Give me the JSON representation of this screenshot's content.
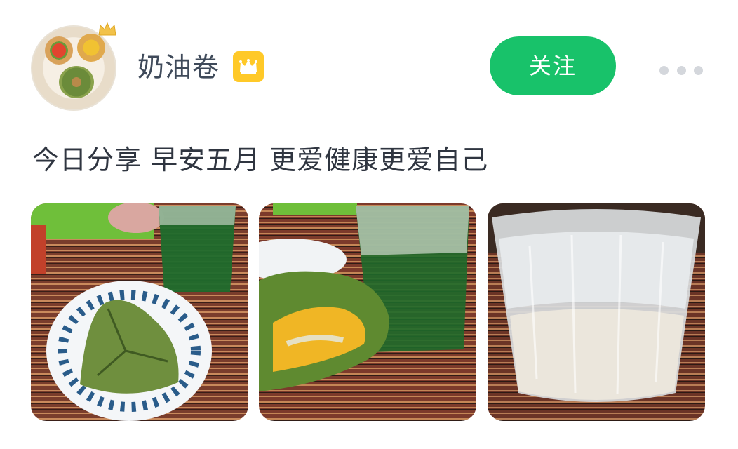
{
  "user": {
    "name": "奶油卷",
    "avatar_icon": "dessert-tarts-avatar",
    "crown_icon": "crown-icon",
    "vip_icon": "crown-vip-badge-icon"
  },
  "actions": {
    "follow_label": "关注",
    "more_icon": "more-dots-icon"
  },
  "post": {
    "text": "今日分享 早安五月 更爱健康更爱自己",
    "photos": [
      {
        "subject": "green matcha bun on striped plate with green juice"
      },
      {
        "subject": "cut green bun with yellow filling and green juice"
      },
      {
        "subject": "glass of milky drink"
      }
    ]
  },
  "colors": {
    "follow_bg": "#18c26a",
    "text": "#2f3540",
    "username": "#3f4a5a",
    "vip_badge": "#ffc928"
  }
}
